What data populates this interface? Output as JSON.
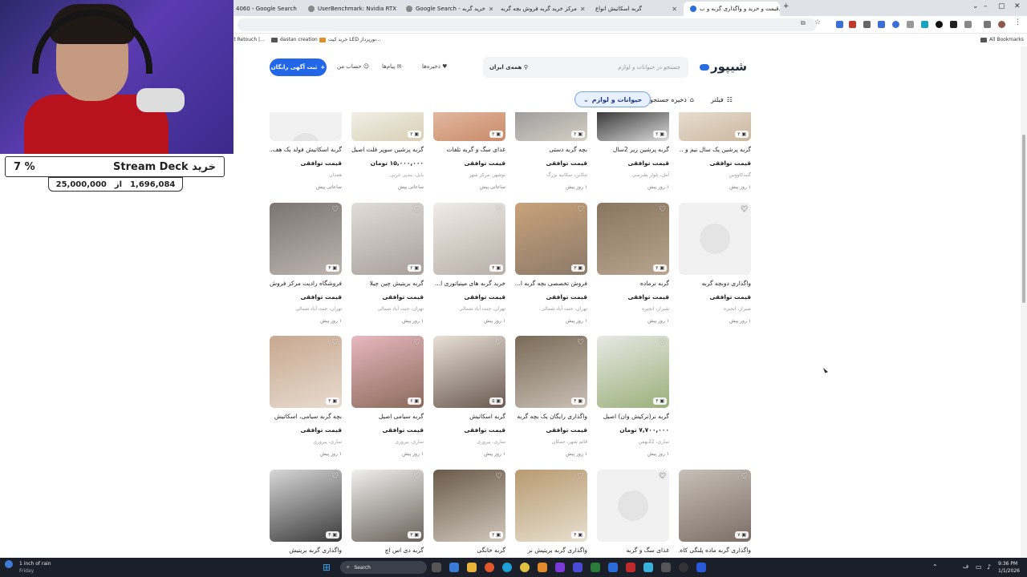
{
  "browser": {
    "tabs": [
      {
        "label": "4060 - Google Search"
      },
      {
        "label": "UserBenchmark: Nvidia RTX 30..."
      },
      {
        "label": "Google Search - خرید گربه"
      },
      {
        "label": "مرکز خرید گربه فروش بچه گربه"
      },
      {
        "label": "گربه اسکاتیش انواع"
      },
      {
        "label": "قیمت و خرید و واگذاری گربه و ب..."
      }
    ],
    "bookmarks": [
      {
        "label": "ait Retouch |..."
      },
      {
        "label": "dastan creation"
      },
      {
        "label": "خرید کیت LED نورپرداز..."
      },
      {
        "label": "All Bookmarks"
      }
    ]
  },
  "header": {
    "logo": "شیپور",
    "search_placeholder": "جستجو در حیوانات و لوازم",
    "location": "همه‌ی ایران",
    "saved": "ذخیره‌ها",
    "messages": "پیام‌ها",
    "account": "حساب من",
    "post_ad": "ثبت آگهی رایگان"
  },
  "filters": {
    "filter": "فیلتر",
    "save_search": "ذخیره جستجو",
    "category": "حیوانات و لوازم"
  },
  "rows": [
    {
      "cards": [
        {
          "title": "گربه پرشین یک سال نیم و ...",
          "price": "قیمت توافقی",
          "loc": "گنبدکاووس",
          "time": "۱ روز پیش",
          "badge": "۲",
          "photo": true,
          "heart": false,
          "c1": "#e8ddd0",
          "c2": "#cbb79f"
        },
        {
          "title": "گربه پرشین زیر 2سال",
          "price": "قیمت توافقی",
          "loc": "آمل، بلوار طبرسی",
          "time": "۱ روز پیش",
          "badge": "۲",
          "photo": true,
          "heart": false,
          "c1": "#3a3a3a",
          "c2": "#dcdcdc"
        },
        {
          "title": "بچه گربه دستی",
          "price": "قیمت توافقی",
          "loc": "تنکابن، سکانیه بزرگ",
          "time": "۱ روز پیش",
          "badge": "۲",
          "photo": true,
          "heart": false,
          "c1": "#9e9e9e",
          "c2": "#d6d0c4"
        },
        {
          "title": "غذای سگ و گربه تلفات",
          "price": "قیمت توافقی",
          "loc": "بوشهر، مرکز شهر",
          "time": "ساعاتی پیش",
          "badge": "۲",
          "photo": true,
          "heart": false,
          "c1": "#e2b8a0",
          "c2": "#c98a6a"
        },
        {
          "title": "گربه پرشین سوپر فلت اصیل",
          "price": "۱۵,۰۰۰,۰۰۰ تومان",
          "loc": "بابل، بندپی غربی",
          "time": "ساعاتی پیش",
          "badge": "۲",
          "photo": true,
          "heart": false,
          "c1": "#f2efe6",
          "c2": "#d8cfb5"
        },
        {
          "title": "گربه اسکاتیش فولد یک هف...",
          "price": "قیمت توافقی",
          "loc": "همدان",
          "time": "ساعاتی پیش",
          "badge": "",
          "photo": false,
          "heart": false,
          "c1": "#f1f1f1",
          "c2": "#e4e4e4"
        }
      ]
    },
    {
      "cards": [
        {
          "title": "واگذاری دوبچه گربه",
          "price": "قیمت توافقی",
          "loc": "شیراز، انجیره",
          "time": "۱ روز پیش",
          "badge": "",
          "photo": false,
          "heart": true,
          "c1": "#f1f1f1",
          "c2": "#e4e4e4"
        },
        {
          "title": "گربه نرماده",
          "price": "قیمت توافقی",
          "loc": "شیراز، انجیره",
          "time": "۱ روز پیش",
          "badge": "۲",
          "photo": true,
          "heart": true,
          "c1": "#8a7560",
          "c2": "#b9a58f"
        },
        {
          "title": "فروش تخصصی بچه گربه ا...",
          "price": "قیمت توافقی",
          "loc": "تهران، جنت آباد شمالی",
          "time": "۱ روز پیش",
          "badge": "۳",
          "photo": true,
          "heart": true,
          "c1": "#c9a27a",
          "c2": "#8c7a6a"
        },
        {
          "title": "خرید گربه های مینیاتوری ا...",
          "price": "قیمت توافقی",
          "loc": "تهران، جنت آباد شمالی",
          "time": "۱ روز پیش",
          "badge": "۴",
          "photo": true,
          "heart": true,
          "c1": "#f0ece6",
          "c2": "#b8b0a8"
        },
        {
          "title": "گربه بریتیش چین چیلا",
          "price": "قیمت توافقی",
          "loc": "تهران، جنت آباد شمالی",
          "time": "۱ روز پیش",
          "badge": "۲",
          "photo": true,
          "heart": true,
          "c1": "#e2ddd8",
          "c2": "#a8a09a"
        },
        {
          "title": "فروشگاه رادیت مرکز فروش ...",
          "price": "قیمت توافقی",
          "loc": "تهران، جنت آباد شمالی",
          "time": "۱ روز پیش",
          "badge": "۳",
          "photo": true,
          "heart": true,
          "c1": "#7c7470",
          "c2": "#bdb5ae"
        }
      ]
    },
    {
      "cards": [
        {
          "title": "گربه نر(ترکیش وان) اصیل",
          "price": "۷,۷۰۰,۰۰۰ تومان",
          "loc": "ساری، 22بهمن",
          "time": "۱ روز پیش",
          "badge": "۳",
          "photo": true,
          "heart": true,
          "c1": "#e8e8e4",
          "c2": "#9ab07a"
        },
        {
          "title": "واگذاری رایگان یک بچه گربه",
          "price": "قیمت توافقی",
          "loc": "قائم شهر، جمکان",
          "time": "۱ روز پیش",
          "badge": "۴",
          "photo": true,
          "heart": true,
          "c1": "#7a6a58",
          "c2": "#c9c0b5"
        },
        {
          "title": "گربه اسکاتیش",
          "price": "قیمت توافقی",
          "loc": "ساری، پیروزی",
          "time": "۱ روز پیش",
          "badge": "۵",
          "photo": true,
          "heart": true,
          "c1": "#e8e0d6",
          "c2": "#6a5a50"
        },
        {
          "title": "گربه سیامی اصیل",
          "price": "قیمت توافقی",
          "loc": "ساری، پیروزی",
          "time": "۱ روز پیش",
          "badge": "۶",
          "photo": true,
          "heart": true,
          "c1": "#e8b8c0",
          "c2": "#8a6a5a"
        },
        {
          "title": "بچه گربه سیامی، اسکاتیش",
          "price": "قیمت توافقی",
          "loc": "ساری، پیروزی",
          "time": "۱ روز پیش",
          "badge": "۳",
          "photo": true,
          "heart": true,
          "c1": "#c8a890",
          "c2": "#e8dcd0"
        }
      ]
    },
    {
      "cards": [
        {
          "title": "واگذاری گربه ماده پلنگی کاه...",
          "price": "",
          "loc": "",
          "time": "",
          "badge": "۷",
          "photo": true,
          "heart": true,
          "c1": "#c8c0b8",
          "c2": "#7a6e66"
        },
        {
          "title": "غذای سگ و گربه",
          "price": "",
          "loc": "",
          "time": "",
          "badge": "",
          "photo": false,
          "heart": true,
          "c1": "#f1f1f1",
          "c2": "#e4e4e4"
        },
        {
          "title": "واگذاری گربه بریتیش نر",
          "price": "",
          "loc": "",
          "time": "",
          "badge": "۴",
          "photo": true,
          "heart": true,
          "c1": "#b89a70",
          "c2": "#e8e0d0"
        },
        {
          "title": "گربه خانگی",
          "price": "",
          "loc": "",
          "time": "",
          "badge": "۲",
          "photo": true,
          "heart": true,
          "c1": "#6a5a4a",
          "c2": "#d0c8bc"
        },
        {
          "title": "گربه دی اس اچ",
          "price": "",
          "loc": "",
          "time": "",
          "badge": "۳",
          "photo": true,
          "heart": true,
          "c1": "#f0f0ee",
          "c2": "#6a625a"
        },
        {
          "title": "واگذاری گربه بریتیش",
          "price": "",
          "loc": "",
          "time": "",
          "badge": "۴",
          "photo": true,
          "heart": true,
          "c1": "#d8d8d8",
          "c2": "#3a3a3a"
        }
      ]
    }
  ],
  "overlay": {
    "goal_title": "خرید Stream Deck",
    "goal_percent": "7 %",
    "goal_current": "1,696,084",
    "goal_of": "از",
    "goal_target": "25,000,000"
  },
  "taskbar": {
    "weather": "1 inch of rain",
    "weather_day": "Friday",
    "search": "Search",
    "time": "9:36 PM",
    "date": "1/1/2026"
  }
}
